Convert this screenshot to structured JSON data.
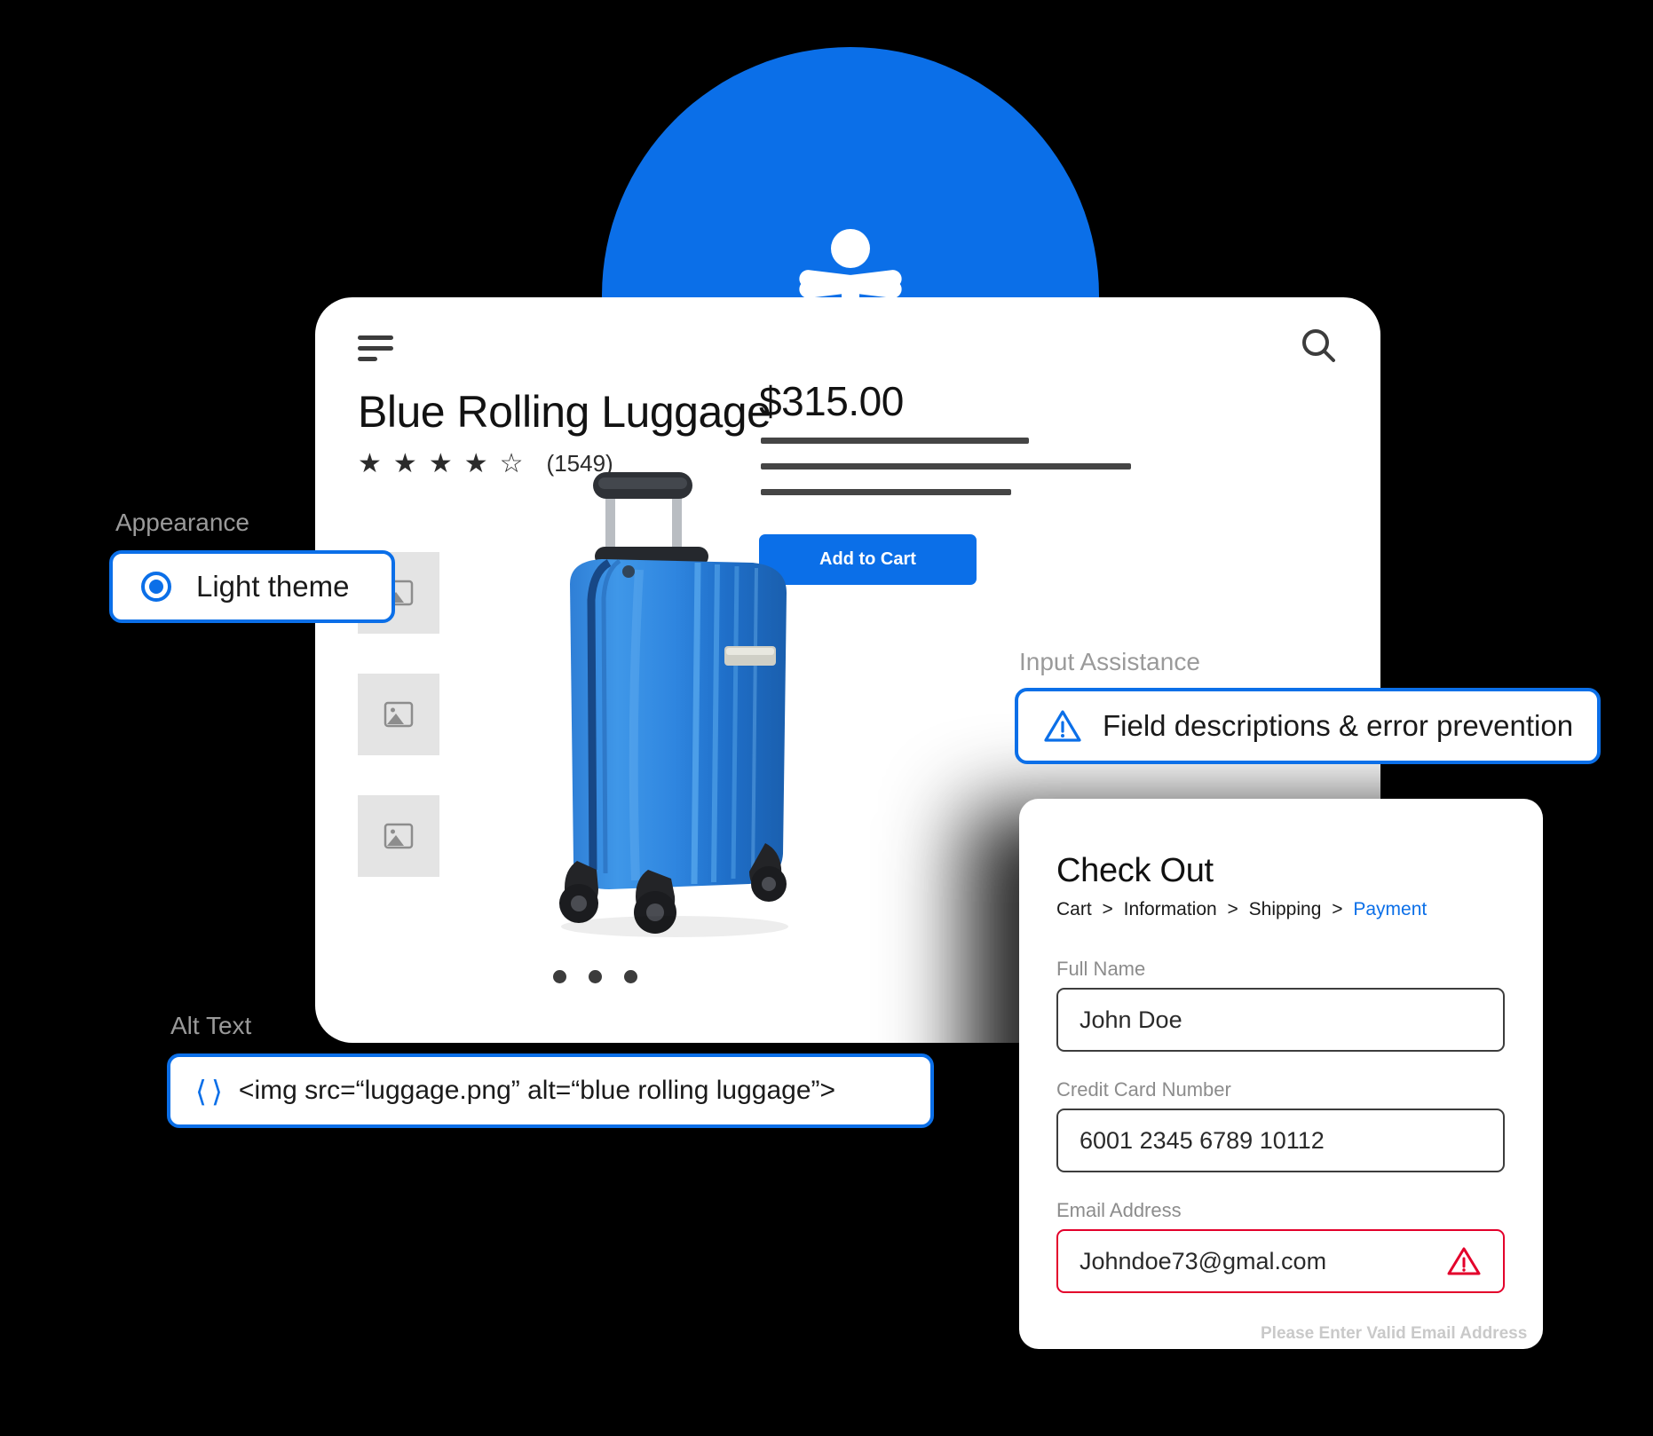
{
  "badge": {
    "icon": "accessibility-person-icon",
    "color": "#0b6fe8"
  },
  "product_card": {
    "menu_icon": "hamburger-menu-icon",
    "search_icon": "search-icon",
    "title": "Blue Rolling Luggage",
    "rating": {
      "filled": 4,
      "total": 5,
      "count_label": "(1549)"
    },
    "price": "$315.00",
    "add_to_cart_label": "Add to Cart",
    "thumbnails": [
      "image-placeholder",
      "image-placeholder",
      "image-placeholder"
    ],
    "product_image_alt": "blue rolling luggage",
    "carousel_dots": 3
  },
  "appearance": {
    "label": "Appearance",
    "option_label": "Light theme",
    "selected": true,
    "accent": "#0b6fe8"
  },
  "input_assistance": {
    "label": "Input Assistance",
    "text": "Field descriptions & error prevention",
    "icon": "warning-triangle-icon",
    "accent": "#0b6fe8"
  },
  "alt_text": {
    "label": "Alt Text",
    "code": "<img src=“luggage.png” alt=“blue rolling luggage”>",
    "icon": "code-brackets-icon",
    "accent": "#0b6fe8"
  },
  "checkout": {
    "title": "Check Out",
    "breadcrumb": [
      "Cart",
      "Information",
      "Shipping",
      "Payment"
    ],
    "breadcrumb_separator": ">",
    "active_step": "Payment",
    "fields": [
      {
        "label": "Full Name",
        "value": "John Doe",
        "state": "normal"
      },
      {
        "label": "Credit Card Number",
        "value": "6001 2345 6789 10112",
        "state": "normal"
      },
      {
        "label": "Email Address",
        "value": "Johndoe73@gmal.com",
        "state": "error",
        "icon": "warning-triangle-icon"
      }
    ],
    "error_message": "Please Enter Valid Email Address",
    "error_color": "#e3002b"
  }
}
